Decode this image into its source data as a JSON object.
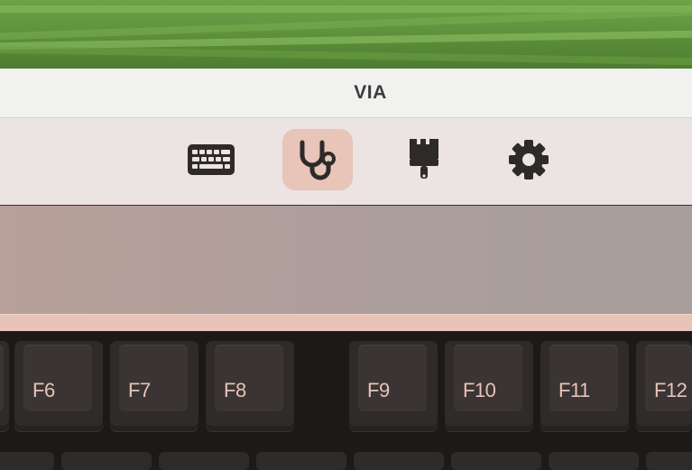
{
  "window": {
    "title": "VIA"
  },
  "toolbar": {
    "tools": [
      {
        "name": "keyboard",
        "icon": "keyboard-icon",
        "active": false
      },
      {
        "name": "test",
        "icon": "stethoscope-icon",
        "active": true
      },
      {
        "name": "design",
        "icon": "paintbrush-icon",
        "active": false
      },
      {
        "name": "settings",
        "icon": "gear-icon",
        "active": false
      }
    ]
  },
  "keyboard": {
    "keys": [
      "F6",
      "F7",
      "F8",
      "F9",
      "F10",
      "F11",
      "F12"
    ]
  },
  "colors": {
    "accent": "#e8c3b8",
    "toolbar_bg": "#ebe4e3",
    "titlebar_bg": "#f1f1ef",
    "keycap": "#2f2b2a"
  }
}
